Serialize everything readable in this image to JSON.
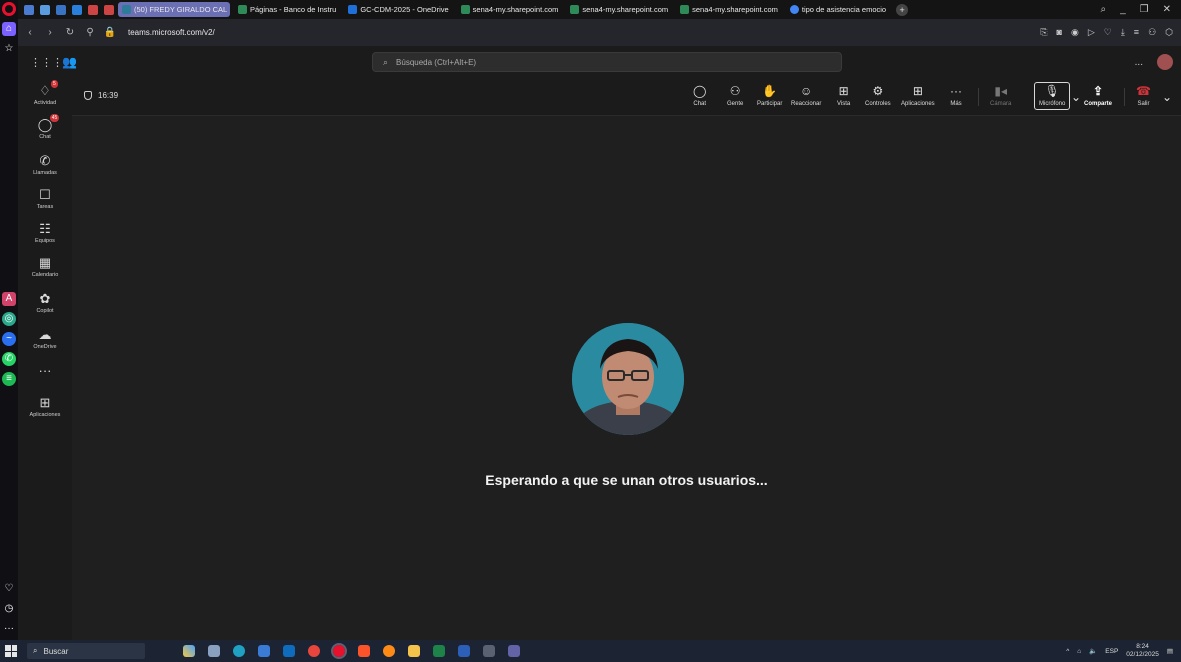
{
  "browser": {
    "tabs": [
      {
        "label": "(50) FREDY GIRALDO CAL",
        "color": "#2d7d9a",
        "active": true
      },
      {
        "label": "Páginas - Banco de Instru",
        "color": "#2e8b57",
        "active": false
      },
      {
        "label": "GC-CDM-2025 - OneDrive",
        "color": "#1e6fd9",
        "active": false
      },
      {
        "label": "sena4-my.sharepoint.com",
        "color": "#2e8b57",
        "active": false
      },
      {
        "label": "sena4-my.sharepoint.com",
        "color": "#2e8b57",
        "active": false
      },
      {
        "label": "sena4-my.sharepoint.com",
        "color": "#2e8b57",
        "active": false
      },
      {
        "label": "tipo de asistencia emocio",
        "color": "#4285f4",
        "active": false
      }
    ],
    "new_tab": "+",
    "url": "teams.microsoft.com/v2/"
  },
  "teams": {
    "search_placeholder": "Búsqueda (Ctrl+Alt+E)",
    "more": "...",
    "rail": [
      {
        "icon": "bell-icon",
        "glyph": "🔔",
        "label": "Actividad",
        "badge": "5"
      },
      {
        "icon": "chat-icon",
        "glyph": "💬",
        "label": "Chat",
        "badge": "45"
      },
      {
        "icon": "phone-icon",
        "glyph": "✆",
        "label": "Llamadas",
        "badge": ""
      },
      {
        "icon": "tasks-icon",
        "glyph": "📋",
        "label": "Tareas",
        "badge": ""
      },
      {
        "icon": "teams-icon",
        "glyph": "👥",
        "label": "Equipos",
        "badge": ""
      },
      {
        "icon": "calendar-icon",
        "glyph": "📅",
        "label": "Calendario",
        "badge": ""
      },
      {
        "icon": "copilot-icon",
        "glyph": "✿",
        "label": "Copilot",
        "badge": ""
      },
      {
        "icon": "onedrive-icon",
        "glyph": "☁",
        "label": "OneDrive",
        "badge": ""
      },
      {
        "icon": "more-icon",
        "glyph": "···",
        "label": "",
        "badge": ""
      },
      {
        "icon": "apps-icon",
        "glyph": "⊞",
        "label": "Aplicaciones",
        "badge": ""
      }
    ],
    "meeting": {
      "timer": "16:39",
      "toolbar": [
        {
          "name": "chat",
          "glyph": "💬",
          "label": "Chat"
        },
        {
          "name": "people",
          "glyph": "👤",
          "label": "Gente"
        },
        {
          "name": "raise-hand",
          "glyph": "✋",
          "label": "Participar"
        },
        {
          "name": "react",
          "glyph": "☺",
          "label": "Reaccionar"
        },
        {
          "name": "view",
          "glyph": "⊞",
          "label": "Vista"
        },
        {
          "name": "controls",
          "glyph": "⚙",
          "label": "Controles"
        },
        {
          "name": "apps",
          "glyph": "⊞",
          "label": "Aplicaciones"
        },
        {
          "name": "more",
          "glyph": "···",
          "label": "Más"
        },
        {
          "name": "camera",
          "glyph": "📷",
          "label": "Cámara"
        },
        {
          "name": "mic",
          "glyph": "🎤",
          "label": "Micrófono"
        },
        {
          "name": "share",
          "glyph": "⬆",
          "label": "Comparte"
        },
        {
          "name": "leave",
          "glyph": "☎",
          "label": "Salir"
        }
      ],
      "waiting_text": "Esperando a que se unan otros usuarios..."
    }
  },
  "taskbar": {
    "search": "Buscar",
    "tray_lang": "ESP",
    "time": "8:24",
    "date": "02/12/2025",
    "tray_up": "^"
  }
}
